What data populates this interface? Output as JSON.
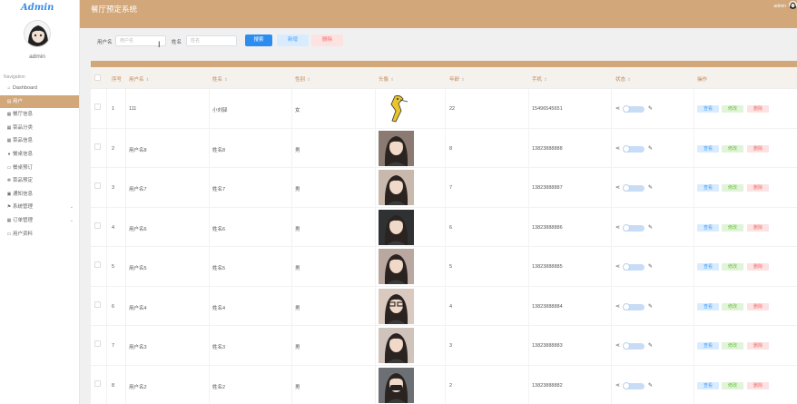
{
  "app": {
    "logo": "Admin",
    "title": "餐厅预定系统",
    "user": "admin"
  },
  "sidebar": {
    "username": "admin",
    "nav_title": "Navigation",
    "items": [
      {
        "label": "Dashboard",
        "icon": "home-icon",
        "glyph": "⌂"
      },
      {
        "label": "用户",
        "icon": "user-icon",
        "glyph": "▤"
      },
      {
        "label": "餐厅信息",
        "icon": "restaurant-icon",
        "glyph": "▦"
      },
      {
        "label": "菜品分类",
        "icon": "grid-icon",
        "glyph": "▦"
      },
      {
        "label": "菜品信息",
        "icon": "grid-icon",
        "glyph": "▦"
      },
      {
        "label": "餐桌信息",
        "icon": "table-icon",
        "glyph": "♦"
      },
      {
        "label": "餐桌预订",
        "icon": "calendar-icon",
        "glyph": "▭"
      },
      {
        "label": "菜品预定",
        "icon": "settings-icon",
        "glyph": "✻"
      },
      {
        "label": "通知信息",
        "icon": "bell-icon",
        "glyph": "▣"
      },
      {
        "label": "系统管理",
        "icon": "flag-icon",
        "glyph": "⚑"
      },
      {
        "label": "订单管理",
        "icon": "grid-icon",
        "glyph": "▦"
      },
      {
        "label": "用户资料",
        "icon": "profile-icon",
        "glyph": "▭"
      }
    ]
  },
  "search": {
    "username_label": "用户名",
    "username_placeholder": "用户名",
    "name_label": "姓名",
    "name_placeholder": "姓名",
    "search_btn": "搜索",
    "add_btn": "新增",
    "delete_btn": "删除"
  },
  "table": {
    "headers": {
      "no": "序号",
      "username": "用户名",
      "name": "姓名",
      "gender": "性别",
      "avatar": "头像",
      "age": "年龄",
      "phone": "手机",
      "status": "状态",
      "action": "操作"
    },
    "sort_glyph": "⇕",
    "actions": {
      "view": "查看",
      "edit": "修改",
      "delete": "删除"
    },
    "share_glyph": "⋖",
    "edit_glyph": "✎",
    "rows": [
      {
        "no": "1",
        "username": "111",
        "name": "小刘驿",
        "gender": "女",
        "age": "22",
        "phone": "15496545651"
      },
      {
        "no": "2",
        "username": "用户名8",
        "name": "姓名8",
        "gender": "男",
        "age": "8",
        "phone": "13823888888"
      },
      {
        "no": "3",
        "username": "用户名7",
        "name": "姓名7",
        "gender": "男",
        "age": "7",
        "phone": "13823888887"
      },
      {
        "no": "4",
        "username": "用户名6",
        "name": "姓名6",
        "gender": "男",
        "age": "6",
        "phone": "13823888886"
      },
      {
        "no": "5",
        "username": "用户名5",
        "name": "姓名5",
        "gender": "男",
        "age": "5",
        "phone": "13823888885"
      },
      {
        "no": "6",
        "username": "用户名4",
        "name": "姓名4",
        "gender": "男",
        "age": "4",
        "phone": "13823888884"
      },
      {
        "no": "7",
        "username": "用户名3",
        "name": "姓名3",
        "gender": "男",
        "age": "3",
        "phone": "13823888883"
      },
      {
        "no": "8",
        "username": "用户名2",
        "name": "姓名2",
        "gender": "男",
        "age": "2",
        "phone": "13823888882"
      }
    ]
  },
  "colors": {
    "brand": "#d2a779",
    "primary": "#2d8cf0"
  }
}
